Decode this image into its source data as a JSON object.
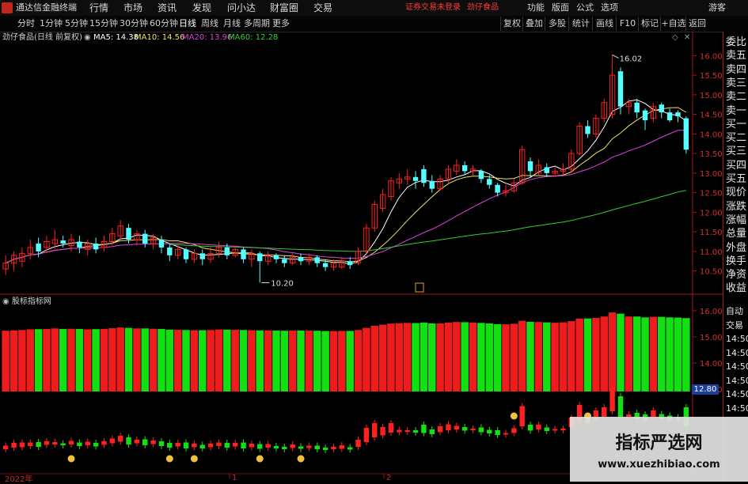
{
  "app": {
    "title": "通达信金融终端"
  },
  "menu": [
    "行情",
    "市场",
    "资讯",
    "发现",
    "问小达",
    "财富圈",
    "交易"
  ],
  "login_notice": "证券交易未登录",
  "stock_name_top": "劲仔食品",
  "menu_right": [
    "功能",
    "版面",
    "公式",
    "选项"
  ],
  "guest": "游客",
  "periods": [
    "分时",
    "1分钟",
    "5分钟",
    "15分钟",
    "30分钟",
    "60分钟",
    "日线",
    "周线",
    "月线",
    "多周期",
    "更多"
  ],
  "active_period": "日线",
  "tools": [
    "复权",
    "叠加",
    "多股",
    "统计",
    "画线",
    "F10",
    "标记",
    "+自选",
    "返回"
  ],
  "chart_title": "劲仔食品(日线 前复权)",
  "ma": {
    "ma5": "MA5: 14.38",
    "ma10": "MA10: 14.56",
    "ma20": "MA20: 13.96",
    "ma60": "MA60: 12.28",
    "colors": {
      "ma5": "#ffffff",
      "ma10": "#f0e060",
      "ma20": "#e040e0",
      "ma60": "#30d030"
    }
  },
  "indicator_title": "股标指标网",
  "right_panel": [
    "委比",
    "卖五",
    "卖四",
    "卖三",
    "卖二",
    "卖一",
    "买一",
    "买二",
    "买三",
    "买四",
    "买五",
    "现价",
    "涨跌",
    "涨幅",
    "总量",
    "外盘",
    "换手",
    "净资",
    "收益"
  ],
  "right_panel_lower": [
    "自动",
    "交易",
    "14:50",
    "14:50",
    "14:50",
    "14:50",
    "14:50",
    "14:50"
  ],
  "last_price_tag": "12.80",
  "year_label": "2022年",
  "axis_labels_bottom": [
    "1",
    "2"
  ],
  "watermark": {
    "title": "指标严选网",
    "url": "www.xuezhibiao.com"
  },
  "chart_data": {
    "type": "candlestick",
    "price_axis": {
      "ticks": [
        "16.00",
        "15.50",
        "15.00",
        "14.50",
        "14.00",
        "13.50",
        "13.00",
        "12.50",
        "12.00",
        "11.50",
        "11.00",
        "10.50"
      ],
      "ylim": [
        10.25,
        16.25
      ]
    },
    "indicator_axis": {
      "ticks": [
        "16.00",
        "15.00",
        "14.00",
        "13.00"
      ]
    },
    "annotations": [
      {
        "label": "16.02",
        "value": 16.02
      },
      {
        "label": "10.20",
        "value": 10.2
      }
    ],
    "candles": [
      {
        "o": 10.55,
        "c": 10.7,
        "h": 10.9,
        "l": 10.4
      },
      {
        "o": 10.7,
        "c": 10.9,
        "h": 11.0,
        "l": 10.5
      },
      {
        "o": 10.75,
        "c": 10.95,
        "h": 11.1,
        "l": 10.6
      },
      {
        "o": 10.95,
        "c": 11.1,
        "h": 11.3,
        "l": 10.8
      },
      {
        "o": 11.2,
        "c": 11.0,
        "h": 11.35,
        "l": 10.85
      },
      {
        "o": 11.1,
        "c": 11.25,
        "h": 11.4,
        "l": 10.95
      },
      {
        "o": 11.2,
        "c": 11.3,
        "h": 11.55,
        "l": 11.05
      },
      {
        "o": 11.28,
        "c": 11.2,
        "h": 11.4,
        "l": 11.1
      },
      {
        "o": 11.15,
        "c": 11.3,
        "h": 11.45,
        "l": 11.0
      },
      {
        "o": 11.25,
        "c": 11.1,
        "h": 11.4,
        "l": 10.95
      },
      {
        "o": 11.05,
        "c": 11.2,
        "h": 11.3,
        "l": 10.9
      },
      {
        "o": 11.2,
        "c": 11.05,
        "h": 11.35,
        "l": 10.95
      },
      {
        "o": 11.1,
        "c": 11.25,
        "h": 11.4,
        "l": 11.0
      },
      {
        "o": 11.25,
        "c": 11.45,
        "h": 11.6,
        "l": 11.15
      },
      {
        "o": 11.4,
        "c": 11.65,
        "h": 11.8,
        "l": 11.3
      },
      {
        "o": 11.6,
        "c": 11.3,
        "h": 11.7,
        "l": 11.2
      },
      {
        "o": 11.3,
        "c": 11.45,
        "h": 11.55,
        "l": 11.15
      },
      {
        "o": 11.45,
        "c": 11.2,
        "h": 11.55,
        "l": 11.1
      },
      {
        "o": 11.2,
        "c": 11.35,
        "h": 11.45,
        "l": 11.05
      },
      {
        "o": 11.3,
        "c": 11.1,
        "h": 11.4,
        "l": 10.95
      },
      {
        "o": 11.1,
        "c": 10.9,
        "h": 11.2,
        "l": 10.75
      },
      {
        "o": 10.9,
        "c": 11.05,
        "h": 11.15,
        "l": 10.8
      },
      {
        "o": 11.05,
        "c": 10.8,
        "h": 11.1,
        "l": 10.7
      },
      {
        "o": 10.8,
        "c": 10.95,
        "h": 11.05,
        "l": 10.7
      },
      {
        "o": 10.95,
        "c": 10.8,
        "h": 11.05,
        "l": 10.65
      },
      {
        "o": 10.8,
        "c": 10.95,
        "h": 11.1,
        "l": 10.7
      },
      {
        "o": 10.95,
        "c": 11.1,
        "h": 11.25,
        "l": 10.85
      },
      {
        "o": 11.1,
        "c": 10.9,
        "h": 11.2,
        "l": 10.8
      },
      {
        "o": 10.9,
        "c": 11.05,
        "h": 11.15,
        "l": 10.85
      },
      {
        "o": 11.05,
        "c": 10.8,
        "h": 11.1,
        "l": 10.7
      },
      {
        "o": 10.8,
        "c": 10.95,
        "h": 11.05,
        "l": 10.6
      },
      {
        "o": 10.95,
        "c": 10.75,
        "h": 11.0,
        "l": 10.2
      },
      {
        "o": 10.75,
        "c": 10.9,
        "h": 11.0,
        "l": 10.65
      },
      {
        "o": 10.9,
        "c": 10.8,
        "h": 10.95,
        "l": 10.7
      },
      {
        "o": 10.8,
        "c": 10.7,
        "h": 10.9,
        "l": 10.6
      },
      {
        "o": 10.7,
        "c": 10.85,
        "h": 10.95,
        "l": 10.65
      },
      {
        "o": 10.85,
        "c": 10.75,
        "h": 10.95,
        "l": 10.65
      },
      {
        "o": 10.75,
        "c": 10.85,
        "h": 10.95,
        "l": 10.65
      },
      {
        "o": 10.85,
        "c": 10.7,
        "h": 10.9,
        "l": 10.6
      },
      {
        "o": 10.7,
        "c": 10.6,
        "h": 10.8,
        "l": 10.5
      },
      {
        "o": 10.6,
        "c": 10.7,
        "h": 10.8,
        "l": 10.5
      },
      {
        "o": 10.6,
        "c": 10.75,
        "h": 10.85,
        "l": 10.55
      },
      {
        "o": 10.75,
        "c": 10.65,
        "h": 10.85,
        "l": 10.55
      },
      {
        "o": 10.7,
        "c": 11.0,
        "h": 11.1,
        "l": 10.65
      },
      {
        "o": 11.0,
        "c": 11.6,
        "h": 11.7,
        "l": 10.95
      },
      {
        "o": 11.6,
        "c": 12.2,
        "h": 12.3,
        "l": 11.5
      },
      {
        "o": 12.1,
        "c": 12.45,
        "h": 12.6,
        "l": 12.0
      },
      {
        "o": 12.4,
        "c": 12.8,
        "h": 12.9,
        "l": 12.3
      },
      {
        "o": 12.75,
        "c": 12.85,
        "h": 13.0,
        "l": 12.6
      },
      {
        "o": 12.85,
        "c": 12.9,
        "h": 13.1,
        "l": 12.7
      },
      {
        "o": 12.9,
        "c": 12.8,
        "h": 13.05,
        "l": 12.6
      },
      {
        "o": 13.1,
        "c": 12.75,
        "h": 13.2,
        "l": 12.65
      },
      {
        "o": 12.8,
        "c": 12.6,
        "h": 12.95,
        "l": 12.5
      },
      {
        "o": 12.6,
        "c": 12.85,
        "h": 12.95,
        "l": 12.55
      },
      {
        "o": 12.85,
        "c": 13.1,
        "h": 13.2,
        "l": 12.75
      },
      {
        "o": 13.05,
        "c": 13.2,
        "h": 13.35,
        "l": 12.95
      },
      {
        "o": 13.2,
        "c": 13.05,
        "h": 13.3,
        "l": 12.95
      },
      {
        "o": 13.05,
        "c": 13.1,
        "h": 13.2,
        "l": 12.95
      },
      {
        "o": 13.05,
        "c": 12.85,
        "h": 13.1,
        "l": 12.75
      },
      {
        "o": 12.85,
        "c": 12.7,
        "h": 12.95,
        "l": 12.6
      },
      {
        "o": 12.7,
        "c": 12.5,
        "h": 12.75,
        "l": 12.4
      },
      {
        "o": 12.5,
        "c": 12.55,
        "h": 12.7,
        "l": 12.4
      },
      {
        "o": 12.55,
        "c": 12.75,
        "h": 12.85,
        "l": 12.5
      },
      {
        "o": 12.75,
        "c": 13.6,
        "h": 13.7,
        "l": 12.7
      },
      {
        "o": 13.3,
        "c": 13.05,
        "h": 13.4,
        "l": 12.9
      },
      {
        "o": 13.0,
        "c": 13.2,
        "h": 13.35,
        "l": 12.95
      },
      {
        "o": 13.15,
        "c": 13.0,
        "h": 13.25,
        "l": 12.9
      },
      {
        "o": 13.0,
        "c": 13.05,
        "h": 13.15,
        "l": 12.9
      },
      {
        "o": 13.05,
        "c": 13.1,
        "h": 13.25,
        "l": 12.95
      },
      {
        "o": 13.1,
        "c": 13.5,
        "h": 13.6,
        "l": 13.0
      },
      {
        "o": 13.5,
        "c": 14.2,
        "h": 14.3,
        "l": 13.45
      },
      {
        "o": 14.2,
        "c": 14.0,
        "h": 14.35,
        "l": 13.9
      },
      {
        "o": 14.0,
        "c": 14.4,
        "h": 14.5,
        "l": 13.9
      },
      {
        "o": 14.4,
        "c": 14.8,
        "h": 14.9,
        "l": 14.3
      },
      {
        "o": 14.5,
        "c": 15.5,
        "h": 16.02,
        "l": 14.4
      },
      {
        "o": 15.6,
        "c": 14.7,
        "h": 15.7,
        "l": 14.5
      },
      {
        "o": 14.7,
        "c": 14.8,
        "h": 14.9,
        "l": 14.5
      },
      {
        "o": 14.8,
        "c": 14.55,
        "h": 14.9,
        "l": 14.4
      },
      {
        "o": 14.6,
        "c": 14.35,
        "h": 14.65,
        "l": 14.1
      },
      {
        "o": 14.4,
        "c": 14.7,
        "h": 14.8,
        "l": 14.3
      },
      {
        "o": 14.75,
        "c": 14.55,
        "h": 14.8,
        "l": 14.4
      },
      {
        "o": 14.55,
        "c": 14.35,
        "h": 14.65,
        "l": 14.3
      },
      {
        "o": 14.55,
        "c": 14.45,
        "h": 14.6,
        "l": 14.3
      },
      {
        "o": 14.4,
        "c": 13.6,
        "h": 14.45,
        "l": 13.5
      }
    ]
  }
}
